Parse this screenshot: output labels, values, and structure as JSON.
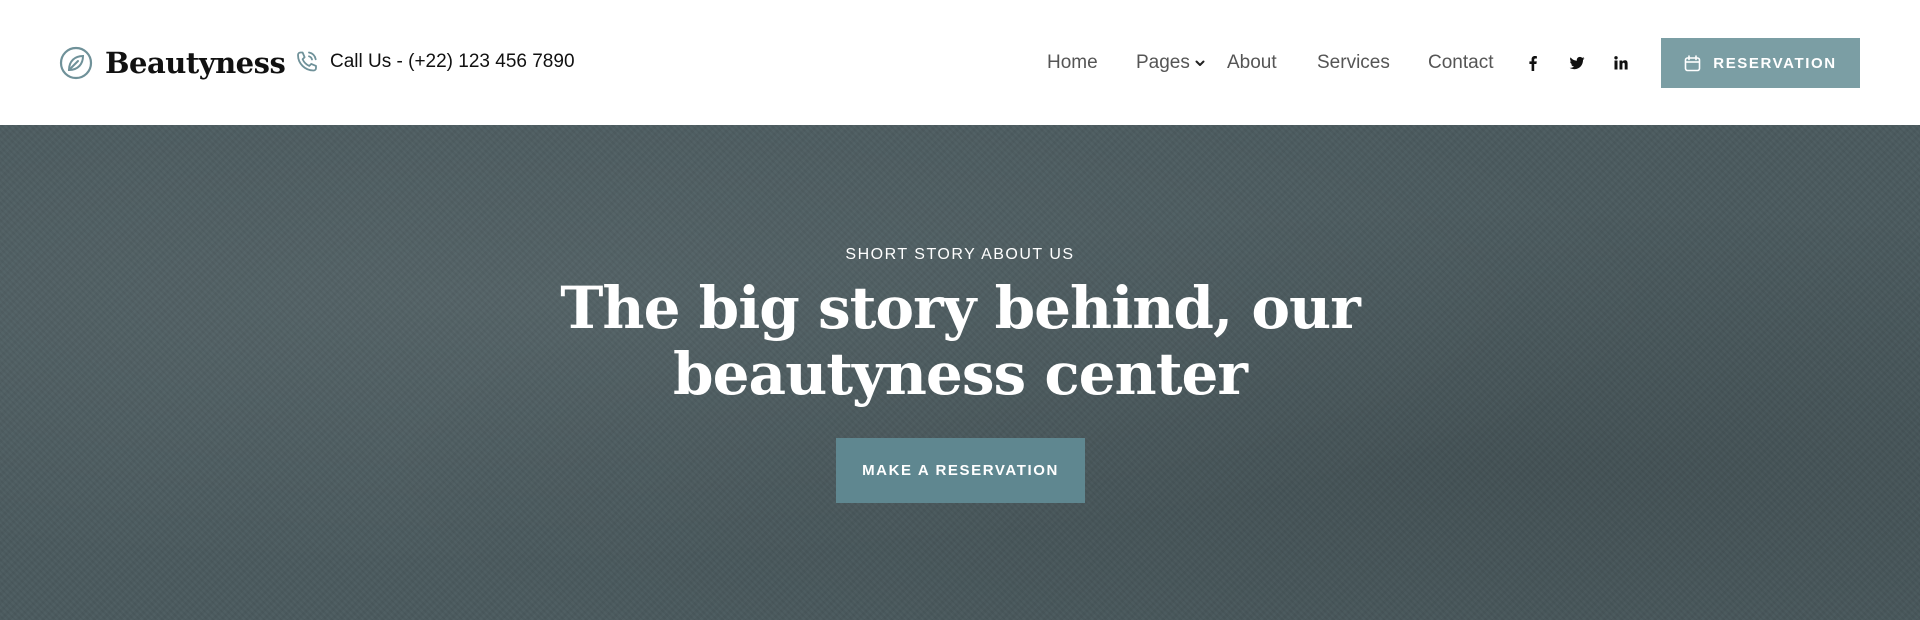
{
  "brand": {
    "name": "Beautyness",
    "icon": "leaf-circle-icon"
  },
  "contact": {
    "label": "Call Us - (+22) 123 456 7890",
    "icon": "phone-icon"
  },
  "nav": {
    "home": "Home",
    "pages": "Pages",
    "about": "About",
    "services": "Services",
    "contact": "Contact"
  },
  "social": [
    "facebook-icon",
    "twitter-icon",
    "linkedin-icon"
  ],
  "header_button": {
    "label": "RESERVATION",
    "icon": "calendar-icon"
  },
  "hero": {
    "eyebrow": "SHORT STORY ABOUT US",
    "title_line1": "The big story behind, our",
    "title_line2": "beautyness center",
    "cta": "MAKE A RESERVATION"
  },
  "colors": {
    "accent": "#7b9ea4",
    "cta_background": "#5f8790",
    "hero_background": "#4a5a5e",
    "text_dark": "#111111",
    "nav_text": "#555555"
  }
}
